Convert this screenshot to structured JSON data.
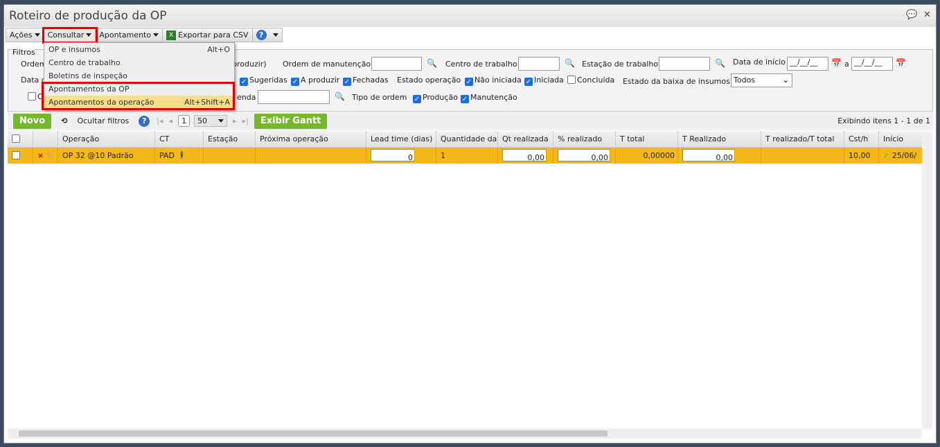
{
  "window": {
    "title": "Roteiro de produção da OP"
  },
  "toolbar": {
    "acoes": "Ações",
    "consultar": "Consultar",
    "apontamento": "Apontamento",
    "export": "Exportar para CSV"
  },
  "menu": [
    {
      "label": "OP e insumos",
      "shortcut": "Alt+O"
    },
    {
      "label": "Centro de trabalho",
      "shortcut": ""
    },
    {
      "label": "Boletins de inspeção",
      "shortcut": ""
    },
    {
      "label": "Apontamentos da OP",
      "shortcut": ""
    },
    {
      "label": "Apontamentos da operação",
      "shortcut": "Alt+Shift+A"
    }
  ],
  "filters": {
    "legend": "Filtros",
    "ordem": "Ordem",
    "a_produzir_paren": "A produzir)",
    "ordem_manutencao": "Ordem de manutenção",
    "centro_trabalho": "Centro de trabalho",
    "estacao_trabalho": "Estação de trabalho",
    "data_inicio": "Data de início",
    "date_placeholder": "__/__/__",
    "a": "a",
    "data_d": "Data d",
    "sugeridas": "Sugeridas",
    "a_produzir": "A produzir",
    "fechadas": "Fechadas",
    "estado_operacao": "Estado operação",
    "nao_iniciada": "Não iniciada",
    "iniciada": "Iniciada",
    "concluida": "Concluída",
    "estado_baixa": "Estado da baixa de insumos",
    "estado_baixa_value": "Todos",
    "o": "O",
    "enda": "enda",
    "tipo_ordem": "Tipo de ordem",
    "producao": "Produção",
    "manutencao": "Manutenção"
  },
  "grid_toolbar": {
    "novo": "Novo",
    "ocultar": "Ocultar filtros",
    "page": "1",
    "page_size": "50",
    "gantt": "Exibir Gantt",
    "info": "Exibindo itens 1 - 1 de 1"
  },
  "columns": [
    "",
    "",
    "Operação",
    "CT",
    "Estação",
    "Próxima operação",
    "Lead time (dias)",
    "Quantidade da",
    "Qt realizada",
    "% realizado",
    "T total",
    "T Realizado",
    "T realizado/T total",
    "Cst/h",
    "Início"
  ],
  "rows": [
    {
      "operacao": "OP 32 @10 Padrão",
      "ct": "PAD",
      "estacao": "",
      "proxima": "",
      "lead": "0",
      "quantidade": "1",
      "qt_realizada": "0,00",
      "pct": "0,00",
      "t_total": "0,00000",
      "t_realizado": "0,00",
      "ratio": "",
      "csth": "10,00",
      "inicio": "25/06/"
    }
  ]
}
